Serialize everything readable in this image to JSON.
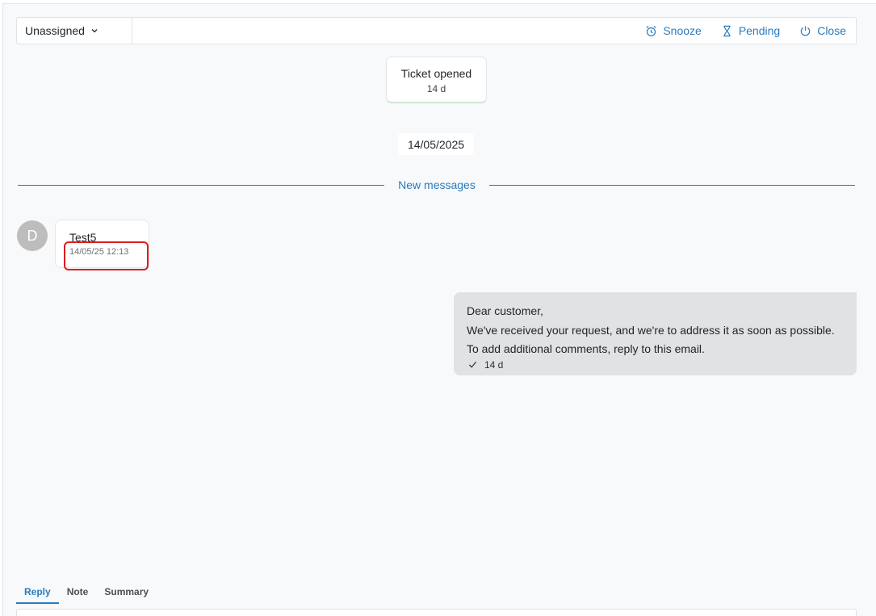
{
  "toolbar": {
    "assignee": "Unassigned",
    "snooze_label": "Snooze",
    "pending_label": "Pending",
    "close_label": "Close"
  },
  "event": {
    "title": "Ticket opened",
    "age": "14 d"
  },
  "date_chip": "14/05/2025",
  "divider_label": "New messages",
  "incoming": {
    "avatar_initial": "D",
    "text": "Test5",
    "timestamp": "14/05/25 12:13"
  },
  "outgoing": {
    "lines": [
      "Dear customer,",
      "We've received your request, and we're to address it as soon as possible.",
      "To add additional comments, reply to this email."
    ],
    "age": "14 d"
  },
  "compose_tabs": [
    "Reply",
    "Note",
    "Summary"
  ],
  "colors": {
    "accent": "#2a7bbd",
    "highlight": "#e01c1c"
  }
}
